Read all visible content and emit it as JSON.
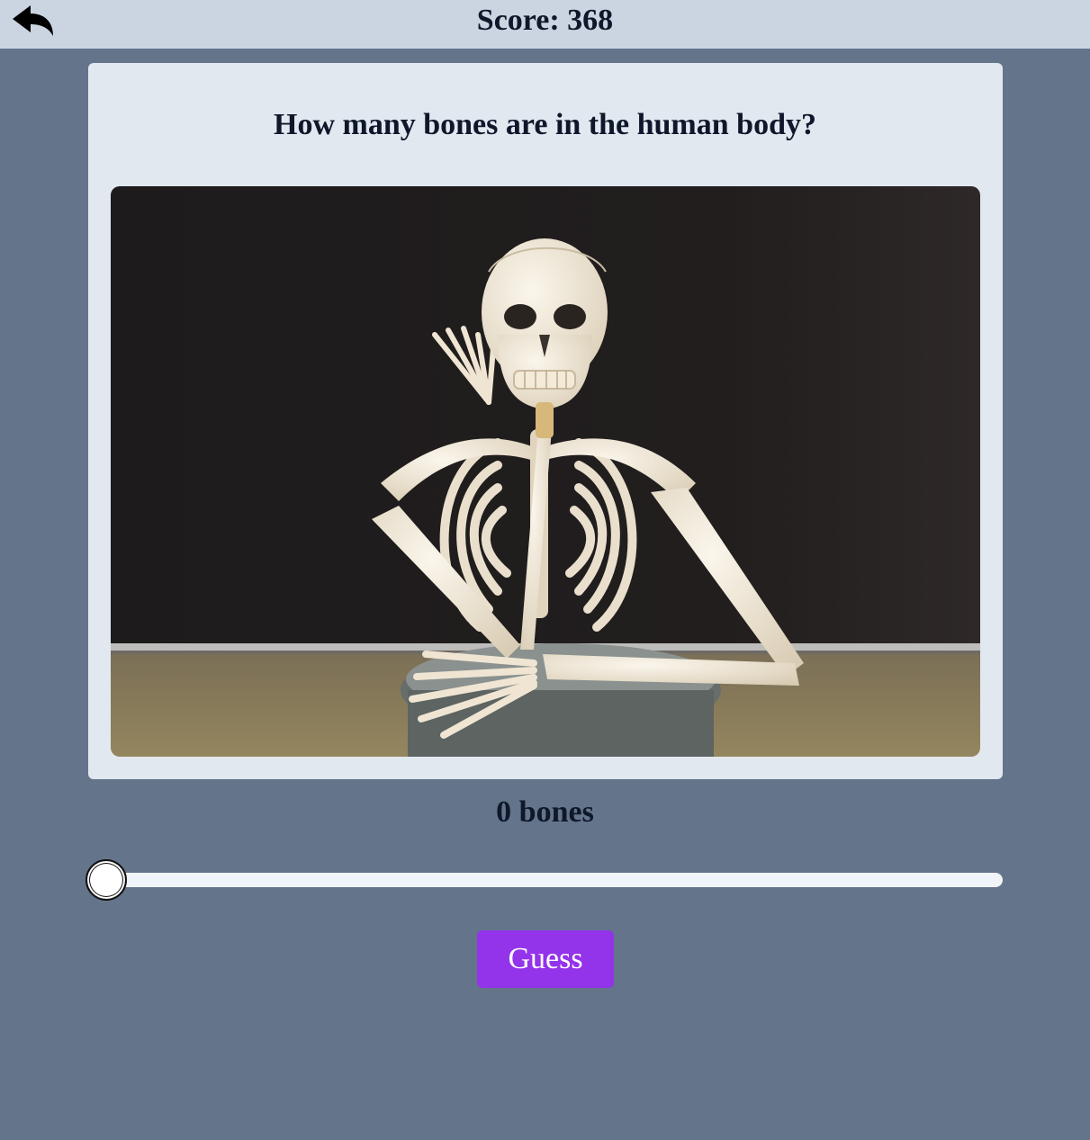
{
  "header": {
    "back_icon": "reply-arrow-icon",
    "score_text": "Score: 368"
  },
  "question": {
    "text": "How many bones are in the human body?",
    "image_subject": "skeleton-photo"
  },
  "answer": {
    "display": "0 bones",
    "slider_value": 0
  },
  "actions": {
    "guess_label": "Guess"
  },
  "colors": {
    "background": "#64748b",
    "topbar": "#cbd5e1",
    "card": "#e2e8f0",
    "guess_button": "#9333ea"
  }
}
